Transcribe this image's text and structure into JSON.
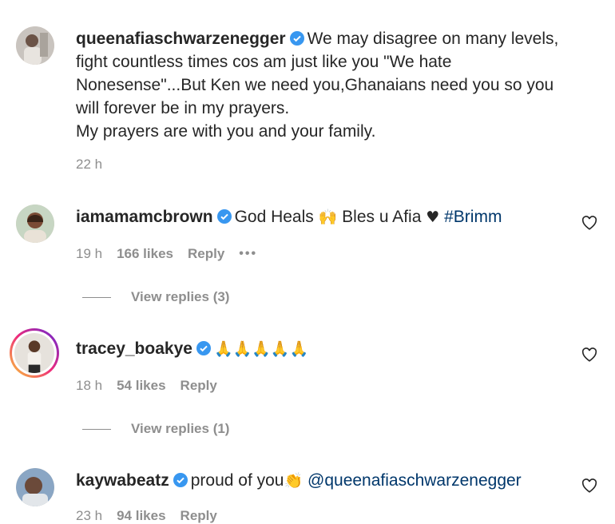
{
  "comments": [
    {
      "username": "queenafiaschwarzenegger",
      "lines": [
        "We may disagree on many levels,",
        "fight countless times cos am just like you \"We hate",
        "Nonesense\"...But Ken we need you,Ghanaians need you so you",
        "will forever be in my prayers.",
        "My prayers are with you and your family."
      ],
      "time": "22 h"
    },
    {
      "username": "iamamamcbrown",
      "text_before": "God Heals",
      "emoji1": "🙌",
      "text_mid": "Bles u Afia",
      "emoji2": "♥",
      "hashtag": "#Brimm",
      "time": "19 h",
      "likes": "166 likes",
      "reply": "Reply",
      "more": "•••",
      "view_replies": "View replies (3)"
    },
    {
      "username": "tracey_boakye",
      "emojis": "🙏🙏🙏🙏🙏",
      "time": "18 h",
      "likes": "54 likes",
      "reply": "Reply",
      "view_replies": "View replies (1)"
    },
    {
      "username": "kaywabeatz",
      "text": "proud of you",
      "emoji": "👏",
      "mention": "@queenafiaschwarzenegger",
      "time": "23 h",
      "likes": "94 likes",
      "reply": "Reply"
    }
  ],
  "icons": {
    "verified_color": "#3897f0",
    "heart": "heart-outline-icon"
  }
}
